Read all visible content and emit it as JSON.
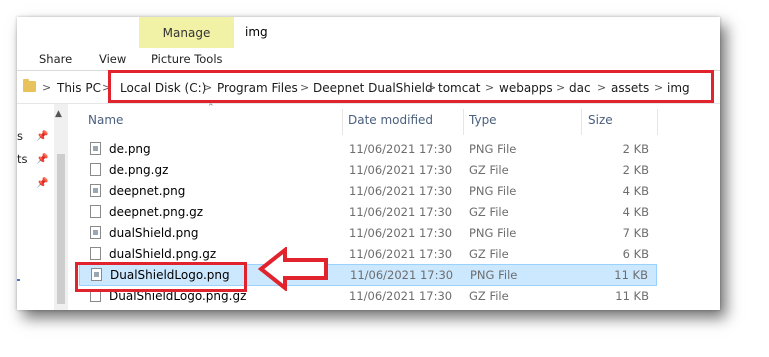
{
  "ribbon": {
    "context_group": "Manage",
    "window_title": "img",
    "tabs": [
      {
        "label": "Share"
      },
      {
        "label": "View"
      },
      {
        "label": "Picture Tools"
      }
    ]
  },
  "address": {
    "root": "This PC",
    "crumbs": [
      "Local Disk (C:)",
      "Program Files",
      "Deepnet DualShield",
      "tomcat",
      "webapps",
      "dac",
      "assets",
      "img"
    ],
    "separator": ">"
  },
  "nav": {
    "items": [
      {
        "label": "s"
      },
      {
        "label": "ts"
      }
    ]
  },
  "columns": {
    "name": "Name",
    "date": "Date modified",
    "type": "Type",
    "size": "Size"
  },
  "files": [
    {
      "name": "de.png",
      "date": "11/06/2021 17:30",
      "type": "PNG File",
      "size": "2 KB",
      "icon": "png-file-icon"
    },
    {
      "name": "de.png.gz",
      "date": "11/06/2021 17:30",
      "type": "GZ File",
      "size": "2 KB",
      "icon": "file-icon"
    },
    {
      "name": "deepnet.png",
      "date": "11/06/2021 17:30",
      "type": "PNG File",
      "size": "4 KB",
      "icon": "png-file-icon"
    },
    {
      "name": "deepnet.png.gz",
      "date": "11/06/2021 17:30",
      "type": "GZ File",
      "size": "4 KB",
      "icon": "file-icon"
    },
    {
      "name": "dualShield.png",
      "date": "11/06/2021 17:30",
      "type": "PNG File",
      "size": "7 KB",
      "icon": "png-file-icon"
    },
    {
      "name": "dualShield.png.gz",
      "date": "11/06/2021 17:30",
      "type": "GZ File",
      "size": "6 KB",
      "icon": "file-icon"
    },
    {
      "name": "DualShieldLogo.png",
      "date": "11/06/2021 17:30",
      "type": "PNG File",
      "size": "11 KB",
      "icon": "png-file-icon",
      "selected": true
    },
    {
      "name": "DualShieldLogo.png.gz",
      "date": "11/06/2021 17:30",
      "type": "GZ File",
      "size": "11 KB",
      "icon": "file-icon"
    }
  ],
  "colors": {
    "annotation_red": "#e0232d",
    "selection": "#cce8ff",
    "context_tab": "#f2f2a6"
  }
}
